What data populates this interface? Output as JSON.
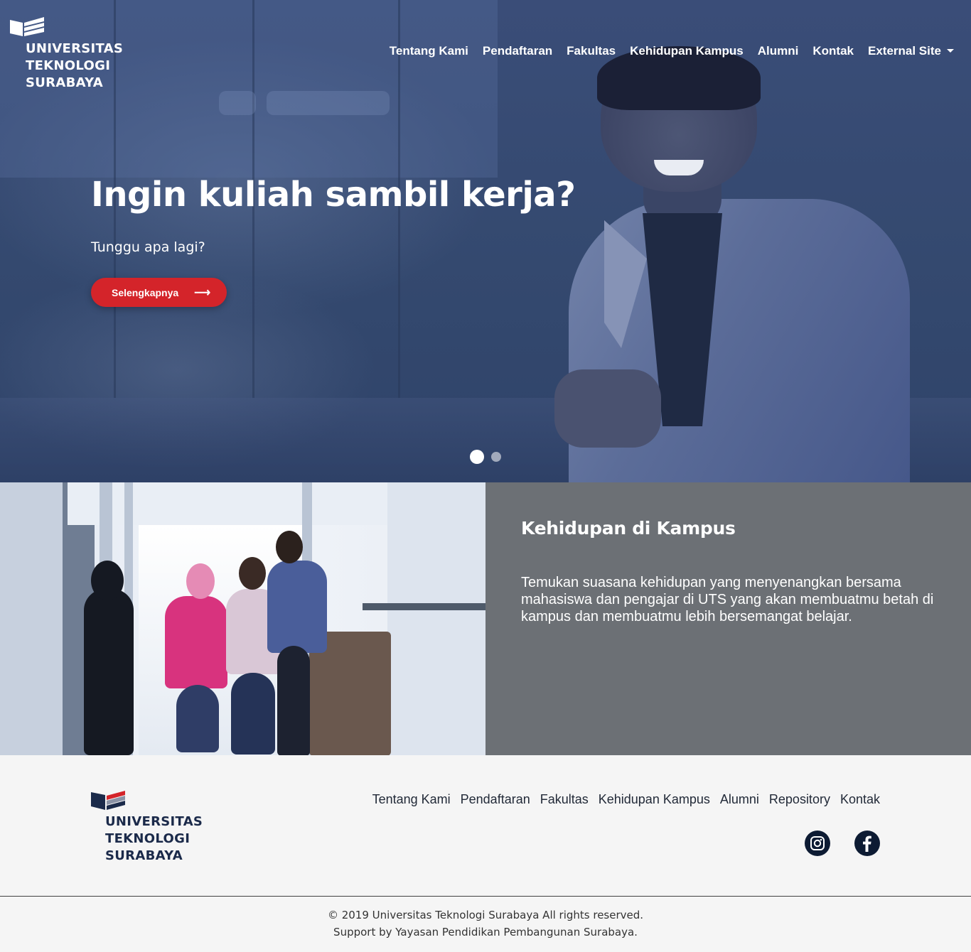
{
  "brand": {
    "line1": "UNIVERSITAS",
    "line2": "TEKNOLOGI",
    "line3": "SURABAYA",
    "accent_red": "#d4242a",
    "navy": "#1b2a4a"
  },
  "nav": {
    "items": [
      "Tentang Kami",
      "Pendaftaran",
      "Fakultas",
      "Kehidupan Kampus",
      "Alumni",
      "Kontak"
    ],
    "dropdown_label": "External Site"
  },
  "hero": {
    "title": "Ingin kuliah sambil kerja?",
    "subtitle": "Tunggu apa lagi?",
    "button_label": "Selengkapnya",
    "button_icon": "arrow-right-icon",
    "slide_count": 2,
    "active_slide": 1
  },
  "campus": {
    "title": "Kehidupan di Kampus",
    "description": "Temukan suasana kehidupan yang menyenangkan bersama mahasiswa dan pengajar di UTS yang akan membuatmu betah di kampus dan membuatmu lebih bersemangat belajar."
  },
  "footer": {
    "nav": [
      "Tentang Kami",
      "Pendaftaran",
      "Fakultas",
      "Kehidupan Kampus",
      "Alumni",
      "Repository",
      "Kontak"
    ],
    "social": [
      "instagram-icon",
      "facebook-icon"
    ],
    "copyright": "© 2019 Universitas Teknologi Surabaya All rights reserved.",
    "support": "Support by Yayasan Pendidikan Pembangunan Surabaya."
  }
}
